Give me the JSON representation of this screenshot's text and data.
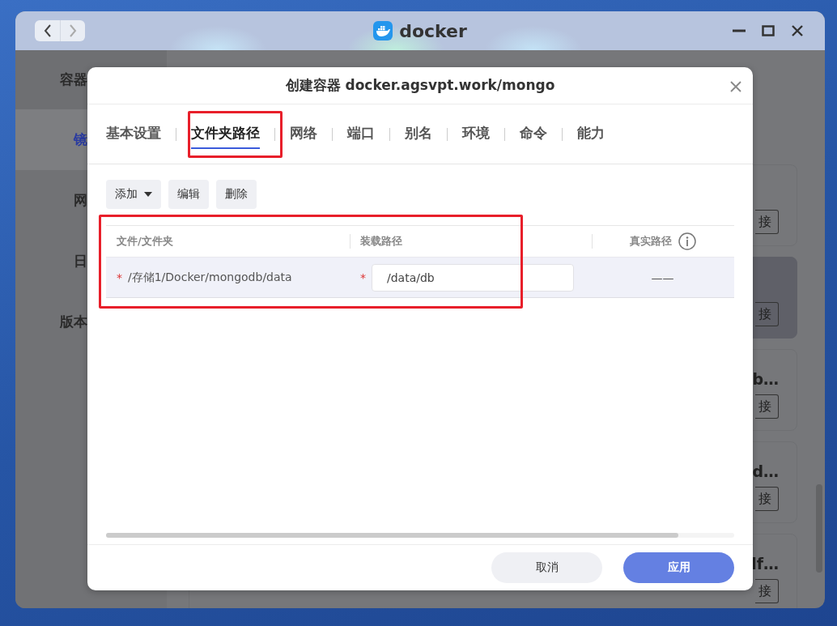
{
  "window": {
    "title": "docker"
  },
  "sidebar": {
    "items": [
      {
        "label": "容器",
        "selected": false
      },
      {
        "label": "镜",
        "selected": true
      },
      {
        "label": "网",
        "selected": false
      },
      {
        "label": "日",
        "selected": false
      },
      {
        "label": "版本",
        "selected": false
      }
    ]
  },
  "cards": [
    {
      "button": "接",
      "selected": false
    },
    {
      "button": "接",
      "selected": true
    },
    {
      "title": "b…",
      "button": "接",
      "selected": false
    },
    {
      "title": "d…",
      "button": "接",
      "selected": false
    },
    {
      "title": "lf…",
      "button": "接",
      "selected": false
    }
  ],
  "dialog": {
    "title": "创建容器 docker.agsvpt.work/mongo",
    "tabs": [
      {
        "label": "基本设置",
        "selected": false
      },
      {
        "label": "文件夹路径",
        "selected": true
      },
      {
        "label": "网络",
        "selected": false
      },
      {
        "label": "端口",
        "selected": false
      },
      {
        "label": "别名",
        "selected": false
      },
      {
        "label": "环境",
        "selected": false
      },
      {
        "label": "命令",
        "selected": false
      },
      {
        "label": "能力",
        "selected": false
      }
    ],
    "toolbar": [
      {
        "label": "添加",
        "kind": "dropdown"
      },
      {
        "label": "编辑",
        "kind": "plain"
      },
      {
        "label": "删除",
        "kind": "plain"
      }
    ],
    "table": {
      "columns": [
        {
          "label": "文件/文件夹"
        },
        {
          "label": "装载路径"
        },
        {
          "label": "真实路径",
          "info": true
        }
      ],
      "rows": [
        {
          "file_mark": "*",
          "file": "/存储1/Docker/mongodb/data",
          "mount_mark": "*",
          "mount": "/data/db",
          "real_path": "——"
        }
      ]
    },
    "buttons": [
      {
        "label": "取消",
        "kind": "secondary"
      },
      {
        "label": "应用",
        "kind": "primary"
      }
    ]
  }
}
